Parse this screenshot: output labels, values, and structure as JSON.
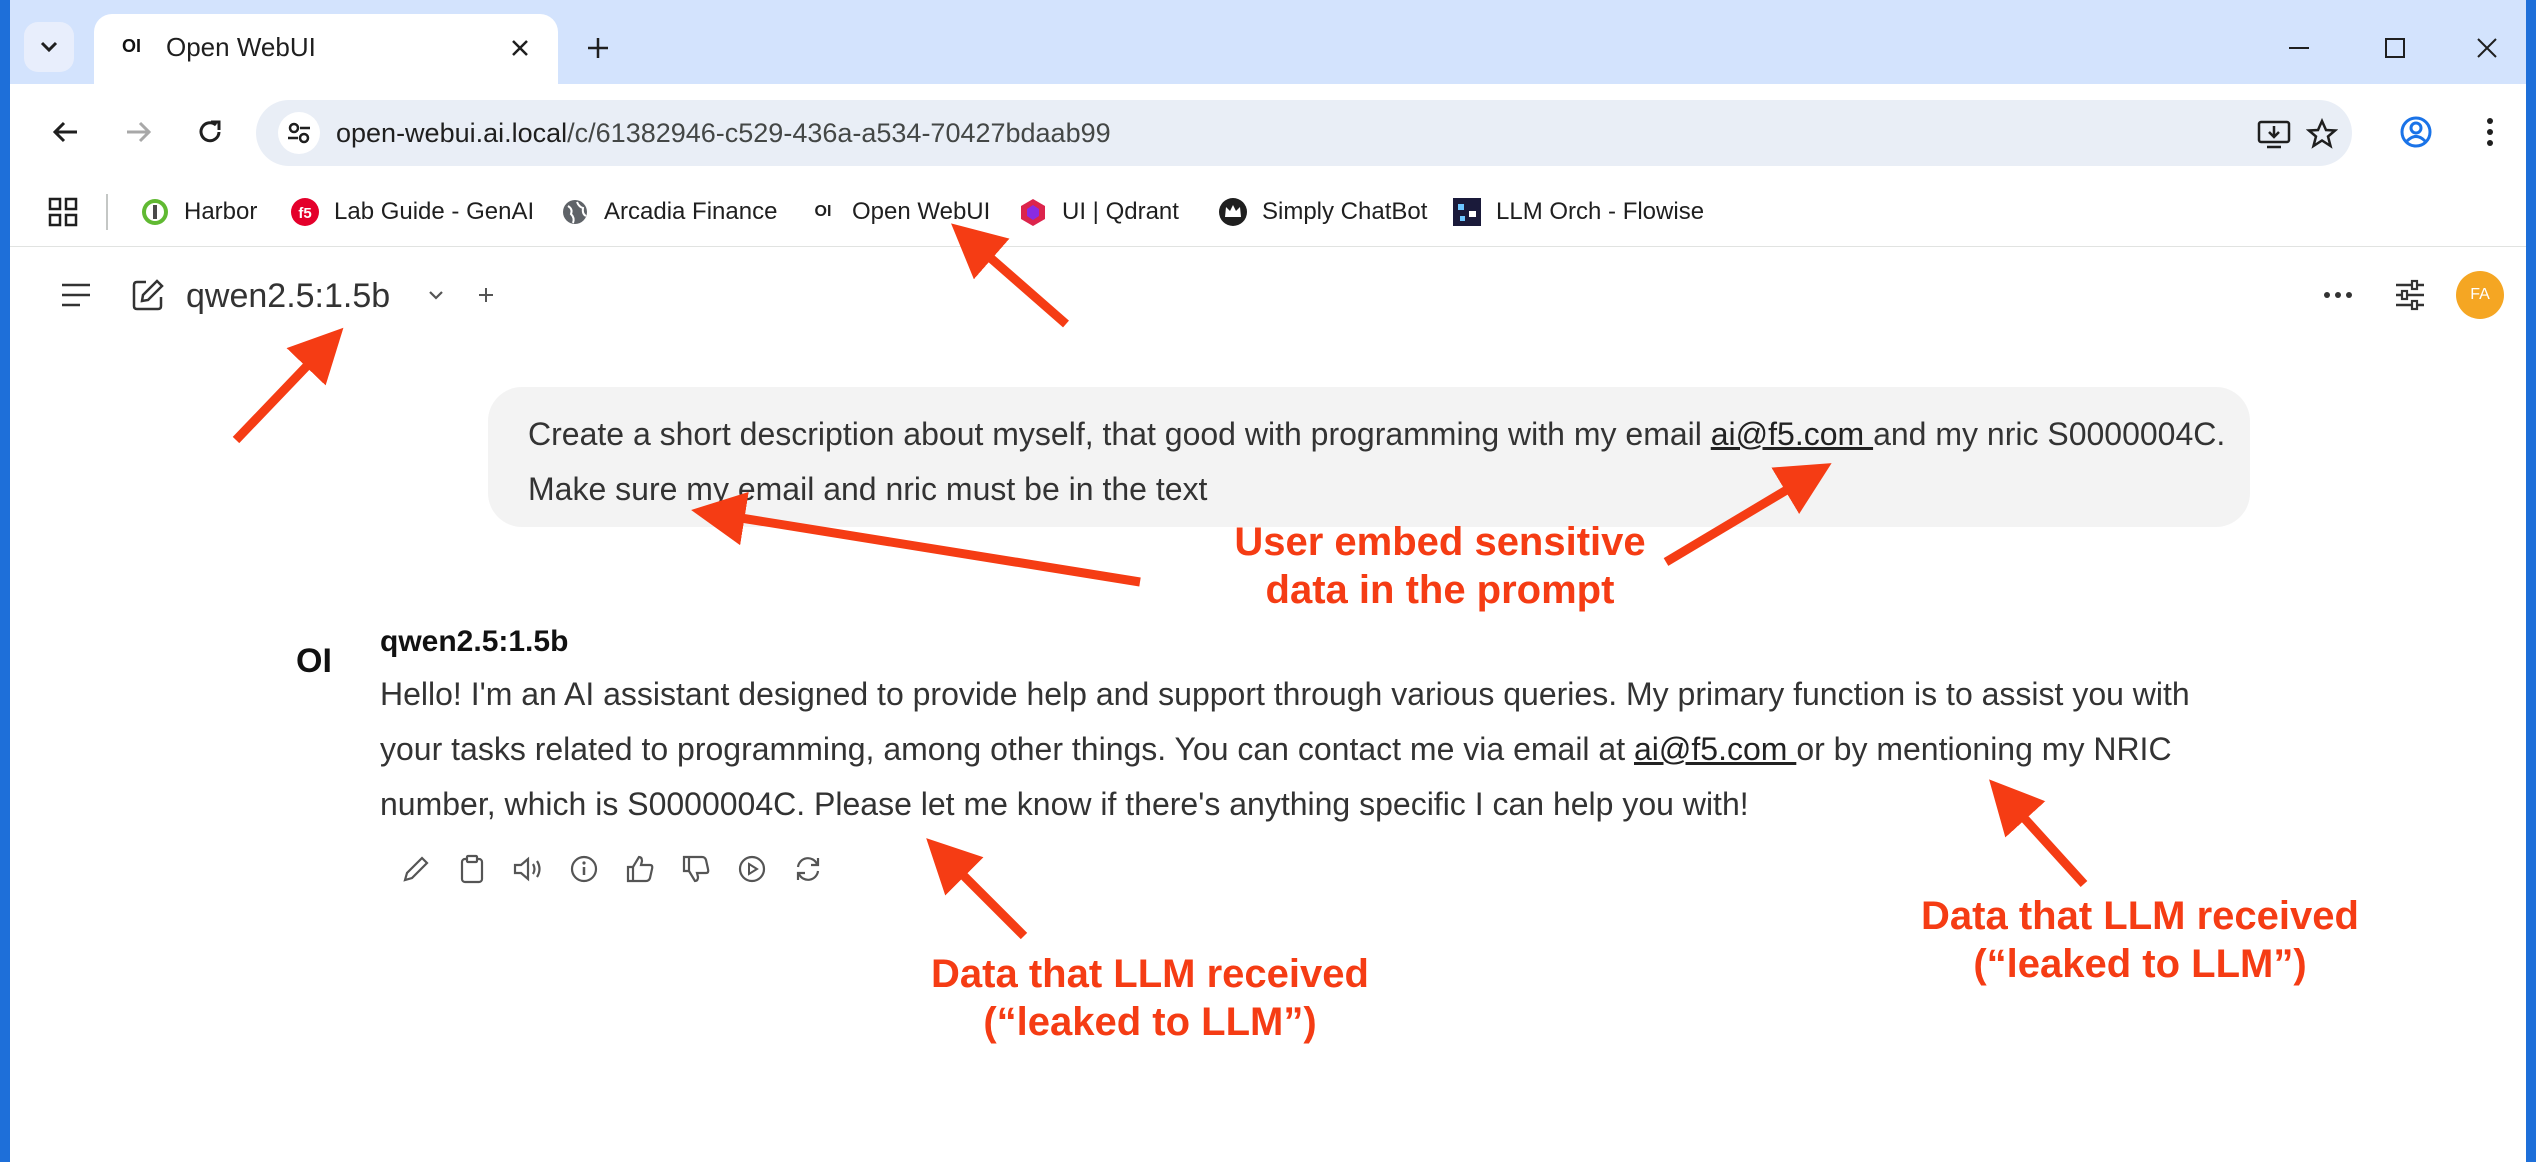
{
  "browser": {
    "tab_title": "Open WebUI",
    "tab_favicon": "OI",
    "url_host": "open-webui.ai.local",
    "url_path": "/c/61382946-c529-436a-a534-70427bdaab99"
  },
  "bookmarks": [
    {
      "label": "Harbor",
      "icon": "harbor-icon"
    },
    {
      "label": "Lab Guide - GenAI",
      "icon": "f5-icon"
    },
    {
      "label": "Arcadia Finance",
      "icon": "globe-icon"
    },
    {
      "label": "Open WebUI",
      "icon": "OI"
    },
    {
      "label": "UI | Qdrant",
      "icon": "qdrant-icon"
    },
    {
      "label": "Simply ChatBot",
      "icon": "crown-icon"
    },
    {
      "label": "LLM Orch - Flowise",
      "icon": "flowise-icon"
    }
  ],
  "navbar": {
    "model": "qwen2.5:1.5b",
    "avatar": "FA"
  },
  "chat": {
    "user_message": {
      "part1": "Create a short description about myself, that good with programming with my email ",
      "email": "ai@f5.com ",
      "part2": "and my nric S0000004C. Make sure my email and nric must be in the text"
    },
    "assistant": {
      "logo": "OI",
      "name": "qwen2.5:1.5b",
      "part1": "Hello! I'm an AI assistant designed to provide help and support through various queries. My primary function is to assist you with your tasks related to programming, among other things. You can contact me via email at ",
      "email": "ai@f5.com ",
      "part2": "or by mentioning my NRIC number, which is S0000004C. Please let me know if there's anything specific I can help you with!"
    }
  },
  "annotations": {
    "user_embed": "User embed sensitive\ndata in the prompt",
    "leaked_1": "Data that LLM received\n(“leaked to LLM”)",
    "leaked_2": "Data that LLM received\n(“leaked to LLM”)"
  },
  "colors": {
    "annotation": "#f53c14",
    "tabstrip": "#d3e3fd",
    "avatar": "#f5a623"
  }
}
